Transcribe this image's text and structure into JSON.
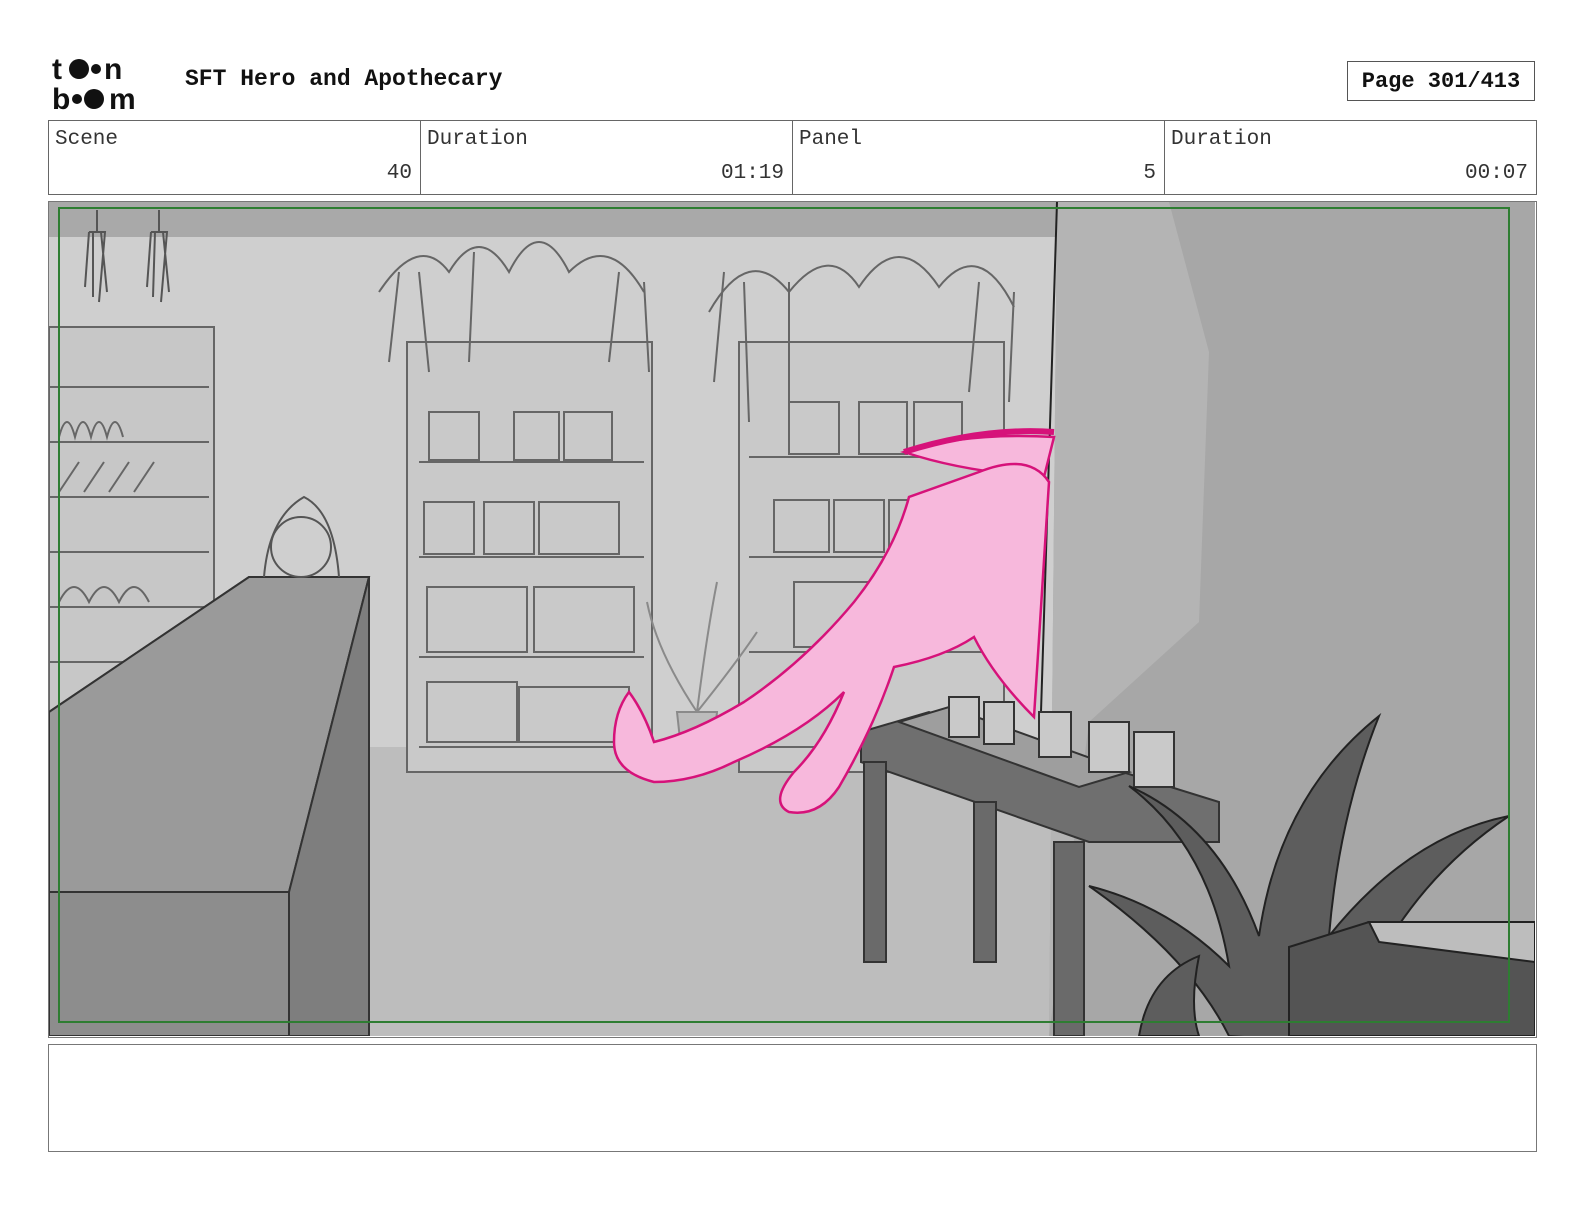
{
  "header": {
    "logo_text": "toon boom",
    "title": "SFT Hero and Apothecary",
    "page_label": "Page 301/413"
  },
  "info": [
    {
      "label": "Scene",
      "value": "40"
    },
    {
      "label": "Duration",
      "value": "01:19"
    },
    {
      "label": "Panel",
      "value": "5"
    },
    {
      "label": "Duration",
      "value": "00:07"
    }
  ],
  "panel": {
    "description": "",
    "safe_frame_color": "#2e7d32",
    "character_color": "#f7b8dc",
    "character_line_color": "#d6127a"
  },
  "notes": {
    "text": ""
  }
}
